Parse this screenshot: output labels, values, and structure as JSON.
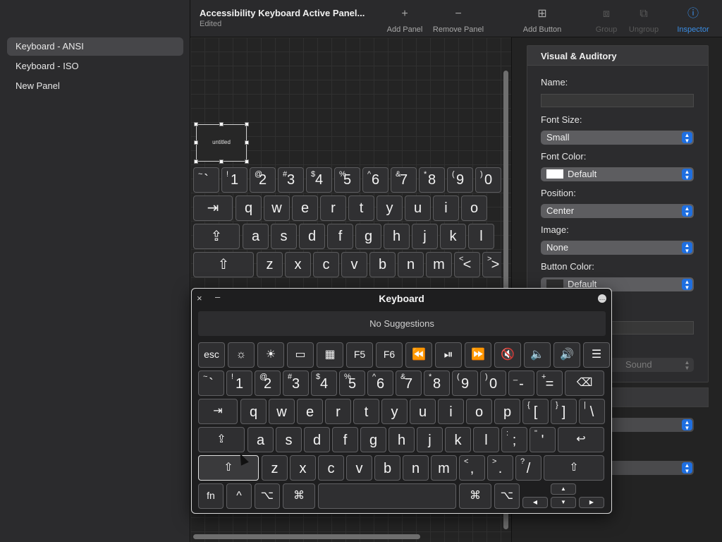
{
  "sidebar": {
    "items": [
      "Keyboard - ANSI",
      "Keyboard - ISO",
      "New Panel"
    ]
  },
  "toolbar": {
    "doc_title": "Accessibility Keyboard Active Panel...",
    "doc_status": "Edited",
    "add_panel": "Add Panel",
    "add_panel_icon": "+",
    "remove_panel": "Remove Panel",
    "remove_panel_icon": "−",
    "add_button": "Add Button",
    "add_button_icon": "⊞",
    "group": "Group",
    "group_icon": "⧈",
    "ungroup": "Ungroup",
    "ungroup_icon": "⧉",
    "inspector": "Inspector",
    "inspector_icon": "ⓘ"
  },
  "canvas": {
    "selected_button_label": "untitled",
    "keys": {
      "row1": [
        [
          "~",
          "`"
        ],
        [
          "!",
          "1"
        ],
        [
          "@",
          "2"
        ],
        [
          "#",
          "3"
        ],
        [
          "$",
          "4"
        ],
        [
          "%",
          "5"
        ],
        [
          "^",
          "6"
        ],
        [
          "&",
          "7"
        ],
        [
          "*",
          "8"
        ],
        [
          "(",
          "9"
        ],
        [
          ")",
          "0"
        ]
      ],
      "row2": [
        "⇥",
        "q",
        "w",
        "e",
        "r",
        "t",
        "y",
        "u",
        "i",
        "o"
      ],
      "row3": [
        "⇪",
        "a",
        "s",
        "d",
        "f",
        "g",
        "h",
        "j",
        "k",
        "l"
      ],
      "row4": [
        "⇧",
        "z",
        "x",
        "c",
        "v",
        "b",
        "n",
        "m",
        "<",
        ">"
      ]
    }
  },
  "inspector": {
    "section_title": "Visual & Auditory",
    "name_label": "Name:",
    "name_value": "",
    "font_size_label": "Font Size:",
    "font_size_value": "Small",
    "font_color_label": "Font Color:",
    "font_color_value": "Default",
    "position_label": "Position:",
    "position_value": "Center",
    "image_label": "Image:",
    "image_value": "None",
    "button_color_label": "Button Color:",
    "button_color_value": "Default",
    "sound_value": "Sound",
    "accent_color": "#1f6fe0"
  },
  "keyboard": {
    "title": "Keyboard",
    "suggestions": "No Suggestions",
    "close_icon": "×",
    "minimize_icon": "–",
    "options_icon": "…",
    "fn_row": [
      "esc",
      "☼",
      "☀",
      "▭",
      "▦",
      "F5",
      "F6",
      "⏪",
      "⏯",
      "⏩",
      "🔇",
      "🔈",
      "🔊",
      "☰"
    ],
    "num_row": [
      [
        "~",
        "`"
      ],
      [
        "!",
        "1"
      ],
      [
        "@",
        "2"
      ],
      [
        "#",
        "3"
      ],
      [
        "$",
        "4"
      ],
      [
        "%",
        "5"
      ],
      [
        "^",
        "6"
      ],
      [
        "&",
        "7"
      ],
      [
        "*",
        "8"
      ],
      [
        "(",
        "9"
      ],
      [
        ")",
        "0"
      ],
      [
        "_",
        "-"
      ],
      [
        "+",
        "="
      ]
    ],
    "delete": "⌫",
    "tab": "⇥",
    "top_row": [
      "q",
      "w",
      "e",
      "r",
      "t",
      "y",
      "u",
      "i",
      "o",
      "p"
    ],
    "top_row_sym": [
      [
        "{",
        "["
      ],
      [
        "}",
        "]"
      ],
      [
        "|",
        "\\"
      ]
    ],
    "caps": "⇪",
    "home_row": [
      "a",
      "s",
      "d",
      "f",
      "g",
      "h",
      "j",
      "k",
      "l"
    ],
    "home_row_sym": [
      [
        ":",
        ";"
      ],
      [
        "\"",
        "'"
      ]
    ],
    "return": "↩",
    "shift": "⇧",
    "bottom_row": [
      "z",
      "x",
      "c",
      "v",
      "b",
      "n",
      "m"
    ],
    "bottom_row_sym": [
      [
        "<",
        ","
      ],
      [
        ">",
        "."
      ],
      [
        "?",
        "/"
      ]
    ],
    "fn": "fn",
    "control": "^",
    "option": "⌥",
    "command": "⌘",
    "arrow_up": "▲",
    "arrow_left": "◀",
    "arrow_down": "▼",
    "arrow_right": "▶"
  }
}
